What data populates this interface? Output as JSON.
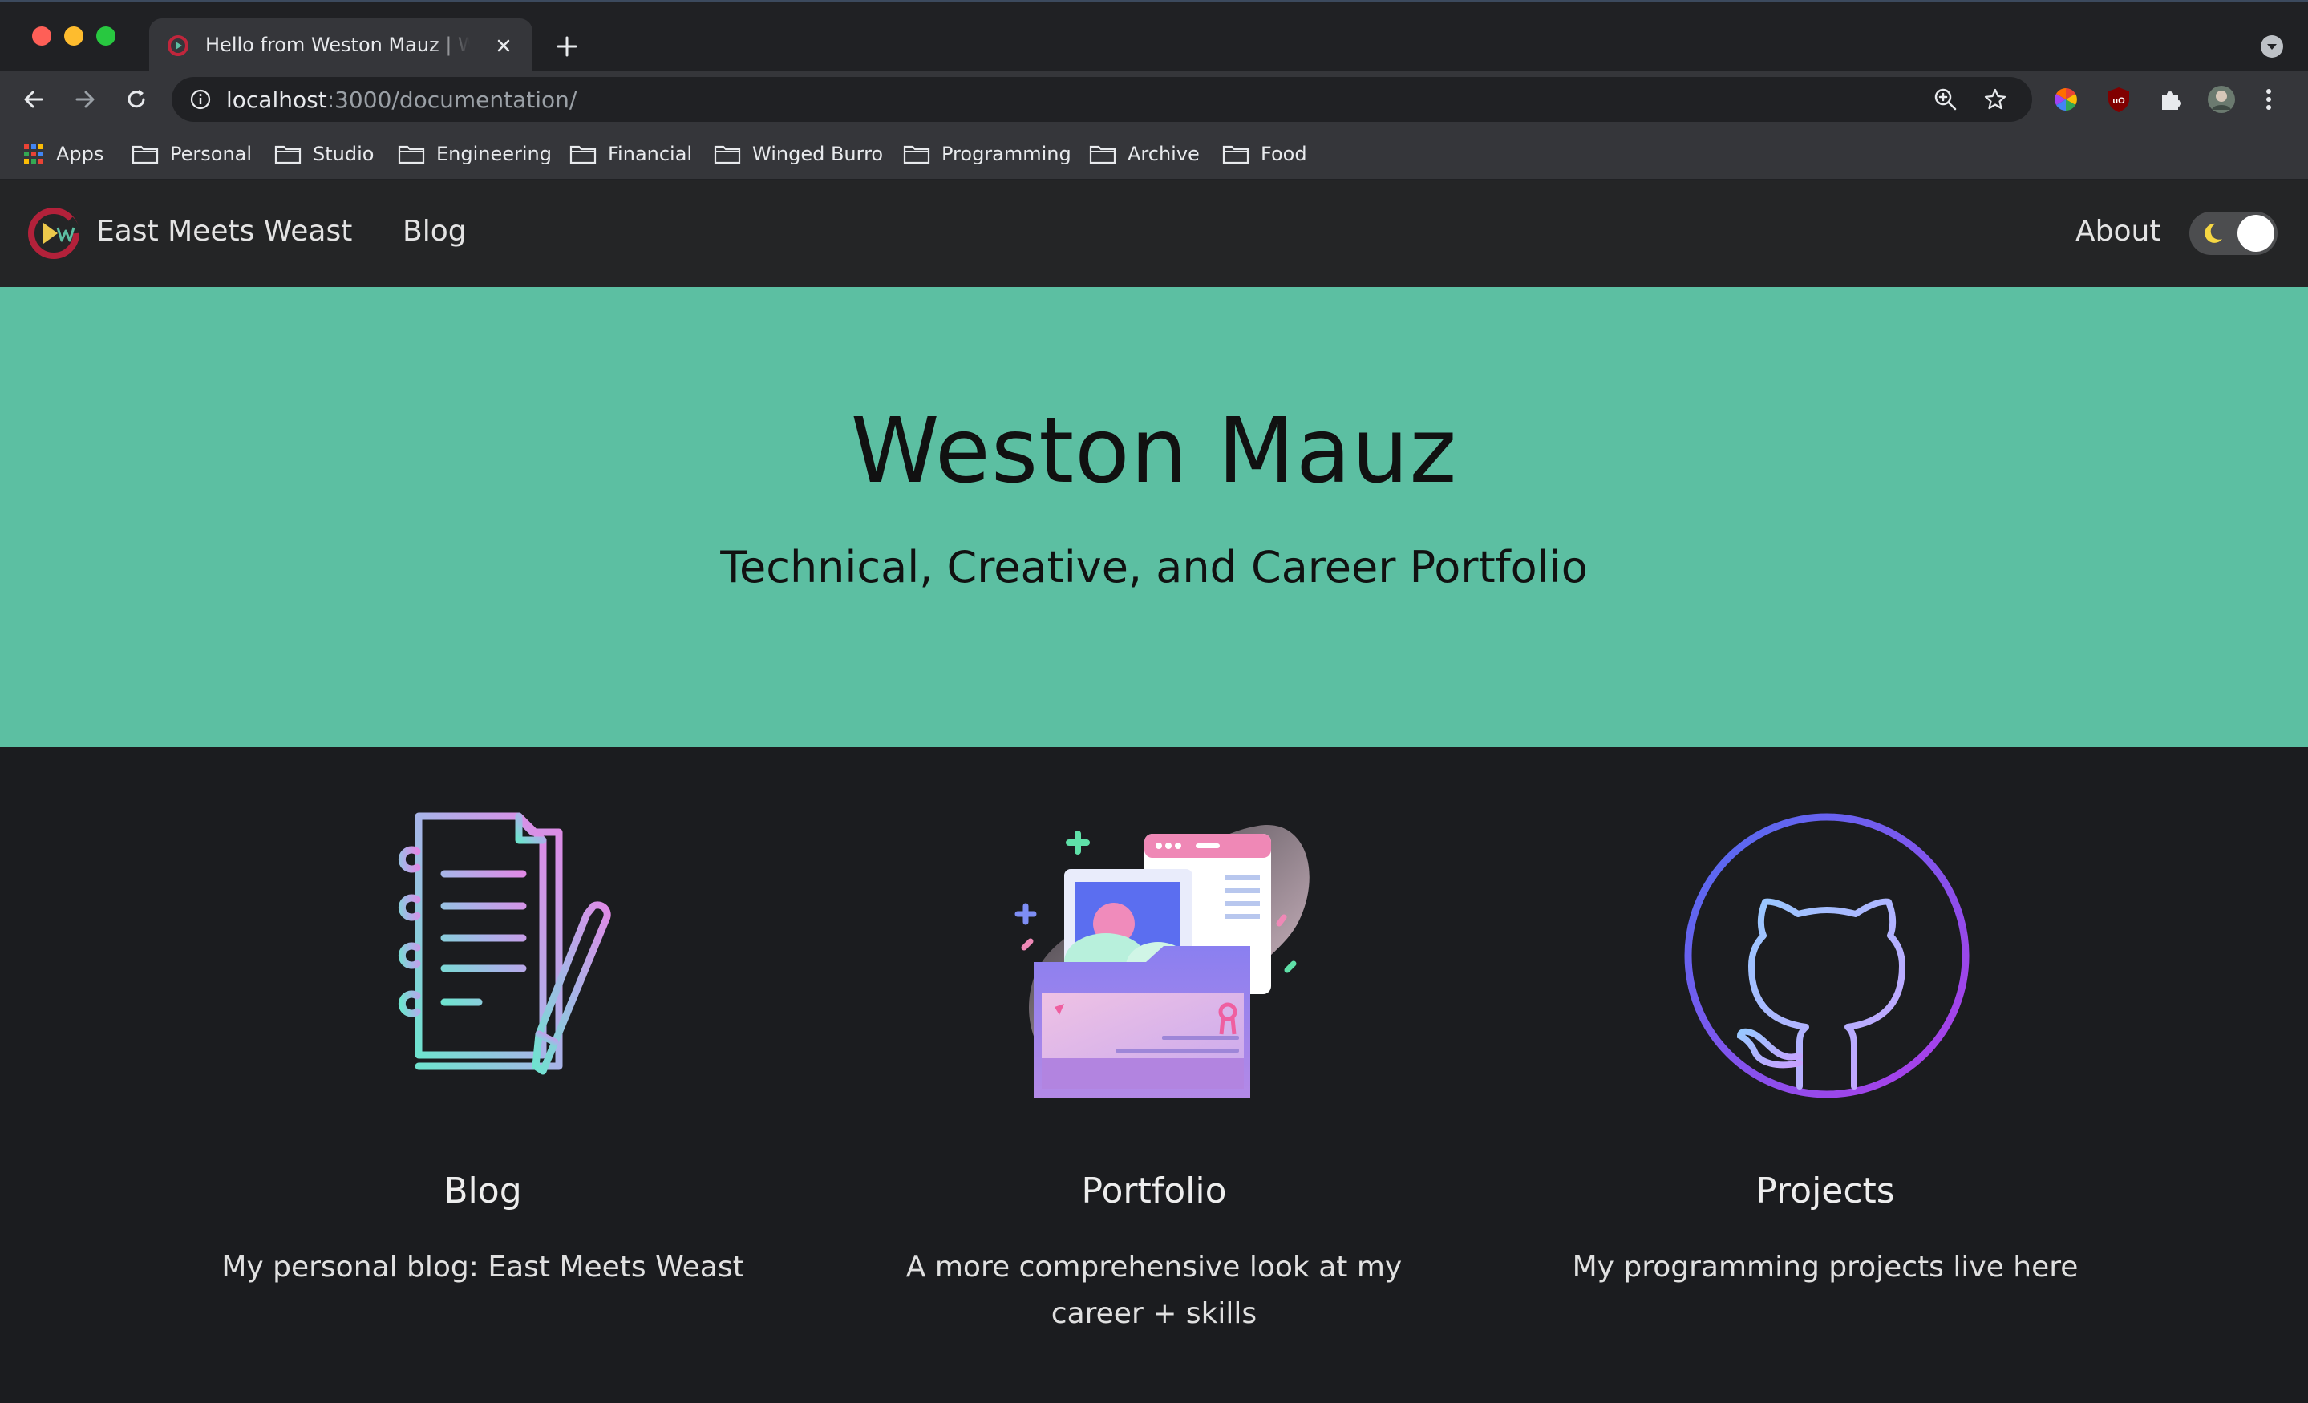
{
  "browser": {
    "tab": {
      "title": "Hello from Weston Mauz | Weston Mauz"
    },
    "url": {
      "host": "localhost",
      "rest": ":3000/documentation/"
    },
    "bookmarks": [
      "Apps",
      "Personal",
      "Studio",
      "Engineering",
      "Financial",
      "Winged Burro",
      "Programming",
      "Archive",
      "Food"
    ]
  },
  "site": {
    "brand": "East Meets Weast",
    "nav": {
      "blog": "Blog",
      "about": "About"
    }
  },
  "hero": {
    "title": "Weston Mauz",
    "subtitle": "Technical, Creative, and Career Portfolio",
    "background": "#5cbfa2"
  },
  "features": [
    {
      "title": "Blog",
      "description": "My personal blog: East Meets Weast",
      "icon": "notebook-pencil-icon"
    },
    {
      "title": "Portfolio",
      "description": "A more comprehensive look at my career + skills",
      "icon": "portfolio-folder-icon"
    },
    {
      "title": "Projects",
      "description": "My programming projects live here",
      "icon": "github-octocat-icon"
    }
  ]
}
